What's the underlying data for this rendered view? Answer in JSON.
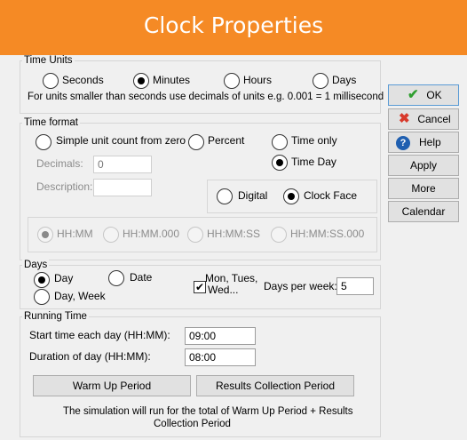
{
  "window": {
    "title": "Clock Properties"
  },
  "time_units": {
    "label": "Time Units",
    "options": [
      "Seconds",
      "Minutes",
      "Hours",
      "Days"
    ],
    "selected": "Minutes",
    "note": "For units smaller than seconds use decimals of units e.g. 0.001 = 1 millisecond"
  },
  "time_format": {
    "label": "Time format",
    "simple_label": "Simple unit count from zero",
    "percent_label": "Percent",
    "time_only_label": "Time only",
    "time_day_label": "Time  Day",
    "selected": "Time  Day",
    "decimals_label": "Decimals:",
    "decimals_value": "0",
    "description_label": "Description:",
    "description_value": "",
    "digital_label": "Digital",
    "clock_face_label": "Clock Face",
    "display_selected": "Clock Face",
    "formats": [
      "HH:MM",
      "HH:MM.000",
      "HH:MM:SS",
      "HH:MM:SS.000"
    ],
    "format_selected": "HH:MM"
  },
  "days": {
    "label": "Days",
    "day_label": "Day",
    "date_label": "Date",
    "day_week_label": "Day, Week",
    "selected": "Day",
    "mon_label_line1": "Mon, Tues,",
    "mon_label_line2": "Wed...",
    "mon_checked": true,
    "days_per_week_label": "Days per week:",
    "days_per_week_value": "5"
  },
  "running_time": {
    "label": "Running Time",
    "start_label": "Start time each day (HH:MM):",
    "start_value": "09:00",
    "duration_label": "Duration of day (HH:MM):",
    "duration_value": "08:00",
    "warmup_button": "Warm Up Period",
    "results_button": "Results Collection Period",
    "note_line1": "The simulation will run for the total of Warm Up Period + Results",
    "note_line2": "Collection Period"
  },
  "side_buttons": {
    "ok": "OK",
    "cancel": "Cancel",
    "help": "Help",
    "apply": "Apply",
    "more": "More",
    "calendar": "Calendar"
  },
  "colors": {
    "titlebar": "#f58a25",
    "ok_check": "#2e9e2e",
    "cancel_x": "#d8392b",
    "help_icon": "#1f5fb0"
  }
}
